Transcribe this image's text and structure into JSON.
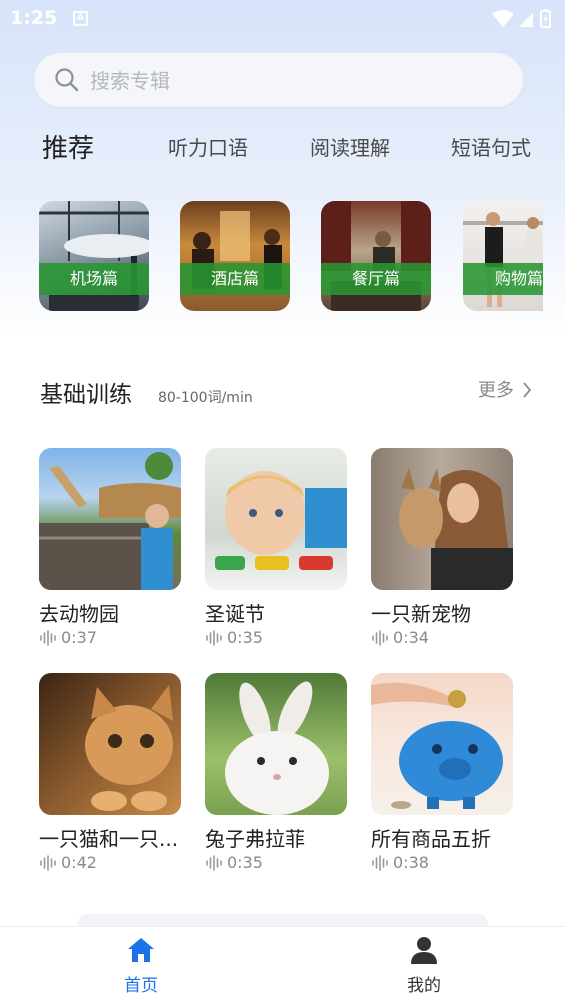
{
  "status_bar": {
    "time": "1:25",
    "notification_icon": "A"
  },
  "search": {
    "placeholder": "搜索专辑"
  },
  "tabs": [
    {
      "label": "推荐",
      "active": true
    },
    {
      "label": "听力口语"
    },
    {
      "label": "阅读理解"
    },
    {
      "label": "短语句式"
    }
  ],
  "scenes": [
    {
      "label": "机场篇"
    },
    {
      "label": "酒店篇"
    },
    {
      "label": "餐厅篇"
    },
    {
      "label": "购物篇"
    }
  ],
  "section": {
    "title": "基础训练",
    "subtitle": "80-100词/min",
    "more_label": "更多"
  },
  "items": [
    {
      "title": "去动物园",
      "duration": "0:37",
      "image": "giraffe-zoo-photo"
    },
    {
      "title": "圣诞节",
      "duration": "0:35",
      "image": "child-toy-cars-photo"
    },
    {
      "title": "一只新宠物",
      "duration": "0:34",
      "image": "woman-dog-photo"
    },
    {
      "title": "一只猫和一只...",
      "duration": "0:42",
      "image": "kitten-photo"
    },
    {
      "title": "兔子弗拉菲",
      "duration": "0:35",
      "image": "white-rabbit-photo"
    },
    {
      "title": "所有商品五折",
      "duration": "0:38",
      "image": "piggy-bank-photo"
    }
  ],
  "nav": {
    "home_label": "首页",
    "mine_label": "我的",
    "active_color": "#1a73e8",
    "inactive_color": "#333333"
  }
}
